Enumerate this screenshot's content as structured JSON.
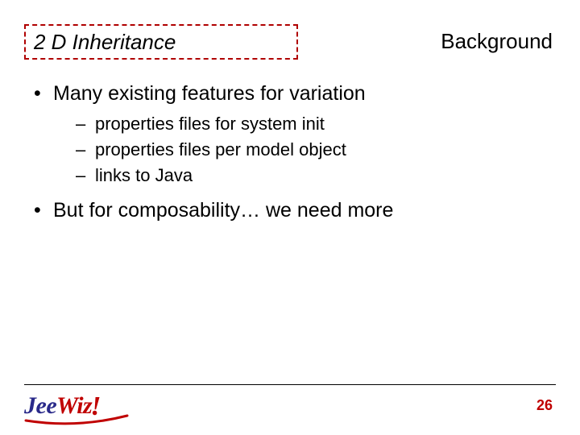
{
  "header": {
    "title": "2 D Inheritance",
    "corner": "Background"
  },
  "body": {
    "bullets": [
      {
        "text": "Many existing features for variation",
        "sub": [
          "properties files for system init",
          "properties files per model object",
          "links to Java"
        ]
      },
      {
        "text": "But for composability… we need more",
        "sub": []
      }
    ]
  },
  "footer": {
    "page": "26",
    "logo": {
      "part1": "Jee",
      "part2": "Wiz",
      "bang": "!"
    }
  }
}
